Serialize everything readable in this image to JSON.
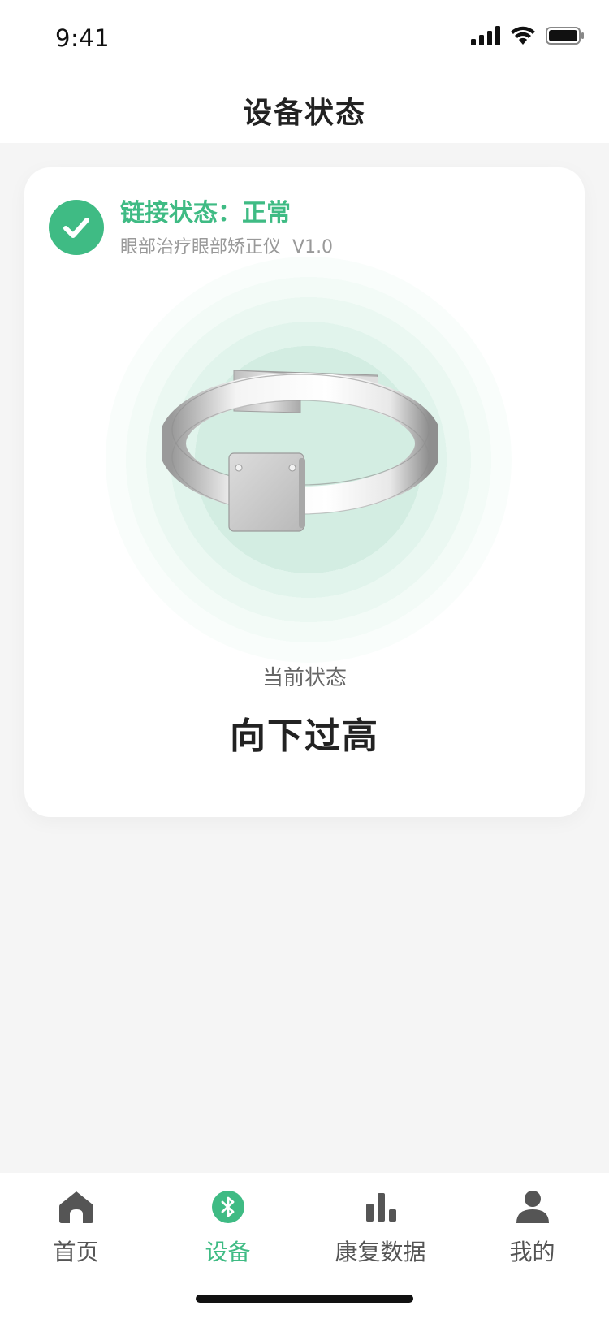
{
  "status_bar": {
    "time": "9:41"
  },
  "header": {
    "title": "设备状态"
  },
  "card": {
    "connection_status": "链接状态：正常",
    "device_name": "眼部治疗眼部矫正仪",
    "version": "V1.0",
    "state_label": "当前状态",
    "state_value": "向下过高"
  },
  "tabs": [
    {
      "label": "首页",
      "icon": "home-icon",
      "active": false
    },
    {
      "label": "设备",
      "icon": "bluetooth-icon",
      "active": true
    },
    {
      "label": "康复数据",
      "icon": "bar-chart-icon",
      "active": false
    },
    {
      "label": "我的",
      "icon": "user-icon",
      "active": false
    }
  ],
  "colors": {
    "accent": "#3fbb84",
    "text_dark": "#222222",
    "text_muted": "#999999",
    "tab_inactive": "#555555",
    "background": "#f5f5f5"
  }
}
